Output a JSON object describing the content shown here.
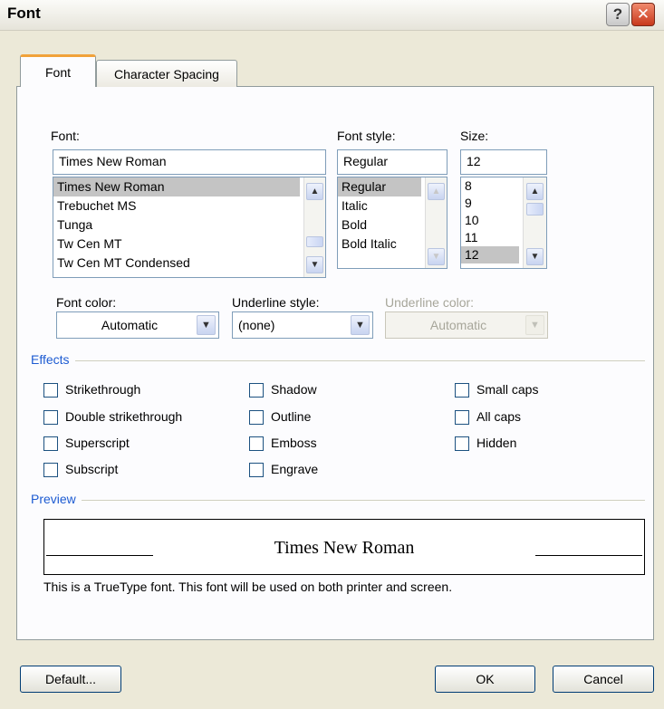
{
  "window": {
    "title": "Font",
    "help_label": "?",
    "close_label": "✕"
  },
  "tabs": [
    {
      "label": "Font",
      "active": true
    },
    {
      "label": "Character Spacing",
      "active": false
    }
  ],
  "font": {
    "label": "Font:",
    "value": "Times New Roman",
    "items": [
      "Times New Roman",
      "Trebuchet MS",
      "Tunga",
      "Tw Cen MT",
      "Tw Cen MT Condensed"
    ],
    "selected": "Times New Roman"
  },
  "font_style": {
    "label": "Font style:",
    "value": "Regular",
    "items": [
      "Regular",
      "Italic",
      "Bold",
      "Bold Italic"
    ],
    "selected": "Regular"
  },
  "size": {
    "label": "Size:",
    "value": "12",
    "items": [
      "8",
      "9",
      "10",
      "11",
      "12"
    ],
    "selected": "12"
  },
  "font_color": {
    "label": "Font color:",
    "value": "Automatic"
  },
  "underline_style": {
    "label": "Underline style:",
    "value": "(none)"
  },
  "underline_color": {
    "label": "Underline color:",
    "value": "Automatic"
  },
  "effects": {
    "title": "Effects",
    "col1": [
      "Strikethrough",
      "Double strikethrough",
      "Superscript",
      "Subscript"
    ],
    "col2": [
      "Shadow",
      "Outline",
      "Emboss",
      "Engrave"
    ],
    "col3": [
      "Small caps",
      "All caps",
      "Hidden"
    ]
  },
  "preview": {
    "title": "Preview",
    "sample": "Times New Roman",
    "description": "This is a TrueType font. This font will be used on both printer and screen."
  },
  "buttons": {
    "default": "Default...",
    "ok": "OK",
    "cancel": "Cancel"
  },
  "colors": {
    "accent": "#1d5bd2",
    "tab_highlight": "#f1a23a",
    "close": "#c8381c"
  }
}
